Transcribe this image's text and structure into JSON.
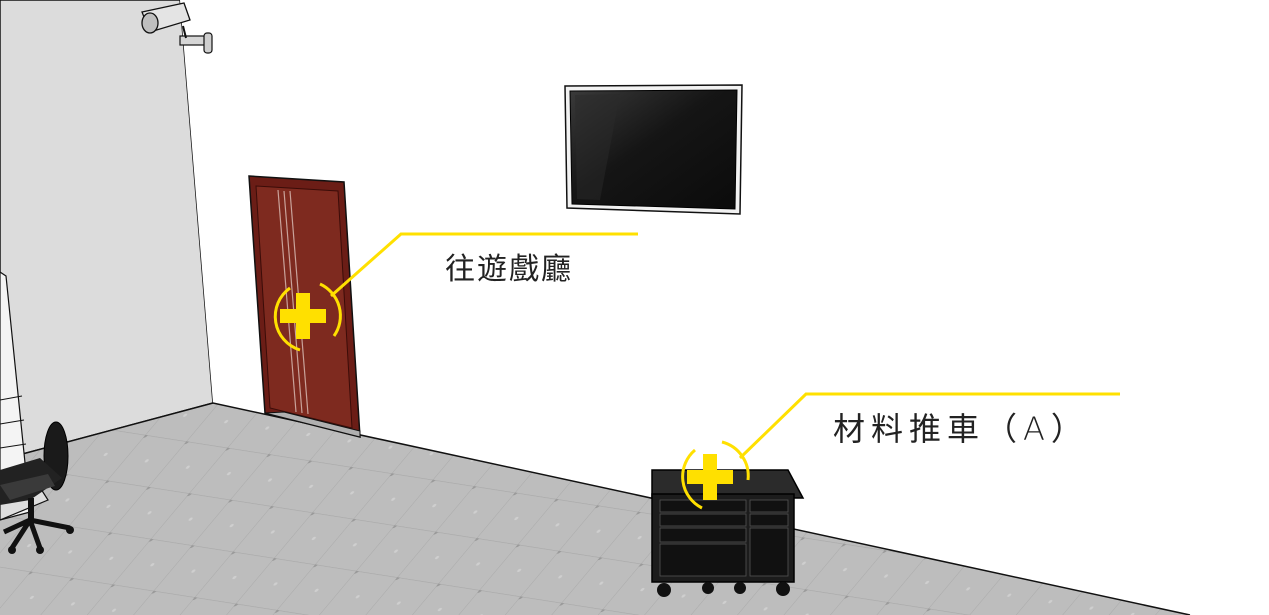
{
  "scene": {
    "hotspots": [
      {
        "id": "door",
        "label": "往遊戲廳",
        "icon": "plus-target-icon"
      },
      {
        "id": "cart",
        "label": "材料推車（A）",
        "icon": "plus-target-icon"
      }
    ],
    "objects": [
      "security-camera",
      "door",
      "wall-tv",
      "tool-cart",
      "office-chair",
      "shelf"
    ]
  },
  "colors": {
    "accent": "#ffe000",
    "door": "#6e1f17",
    "floor": "#b9b9b9",
    "left_wall": "#dcdcdc",
    "back_wall": "#ffffff",
    "cart": "#1c1c1c"
  }
}
